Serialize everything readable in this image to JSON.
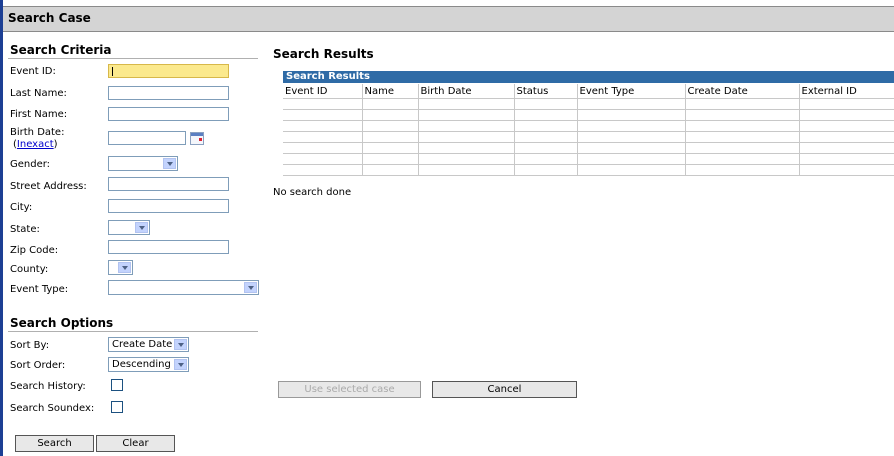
{
  "window": {
    "title": "Search Case"
  },
  "criteria": {
    "title": "Search Criteria",
    "event_id_label": "Event ID:",
    "last_name_label": "Last Name:",
    "first_name_label": "First Name:",
    "birth_date_label": "Birth Date:",
    "inexact_prefix": "(",
    "inexact_link": "Inexact",
    "inexact_suffix": ")",
    "gender_label": "Gender:",
    "street_label": "Street Address:",
    "city_label": "City:",
    "state_label": "State:",
    "zip_label": "Zip Code:",
    "county_label": "County:",
    "event_type_label": "Event Type:"
  },
  "options": {
    "title": "Search Options",
    "sort_by_label": "Sort By:",
    "sort_by_value": "Create Date",
    "sort_order_label": "Sort Order:",
    "sort_order_value": "Descending",
    "history_label": "Search History:",
    "soundex_label": "Search Soundex:"
  },
  "buttons": {
    "search": "Search",
    "clear": "Clear",
    "use_selected": "Use selected case",
    "cancel": "Cancel"
  },
  "results": {
    "title": "Search Results",
    "grid_caption": "Search Results",
    "columns": [
      "Event ID",
      "Name",
      "Birth Date",
      "Status",
      "Event Type",
      "Create Date",
      "External ID"
    ],
    "status_text": "No search done"
  },
  "icons": {
    "calendar": "calendar-icon",
    "dropdown": "chevron-down-icon"
  },
  "colors": {
    "titlebar": "#d4d4d4",
    "grid_header": "#2f6ba6",
    "focused_field": "#fbe98d",
    "link": "#0000cc"
  }
}
